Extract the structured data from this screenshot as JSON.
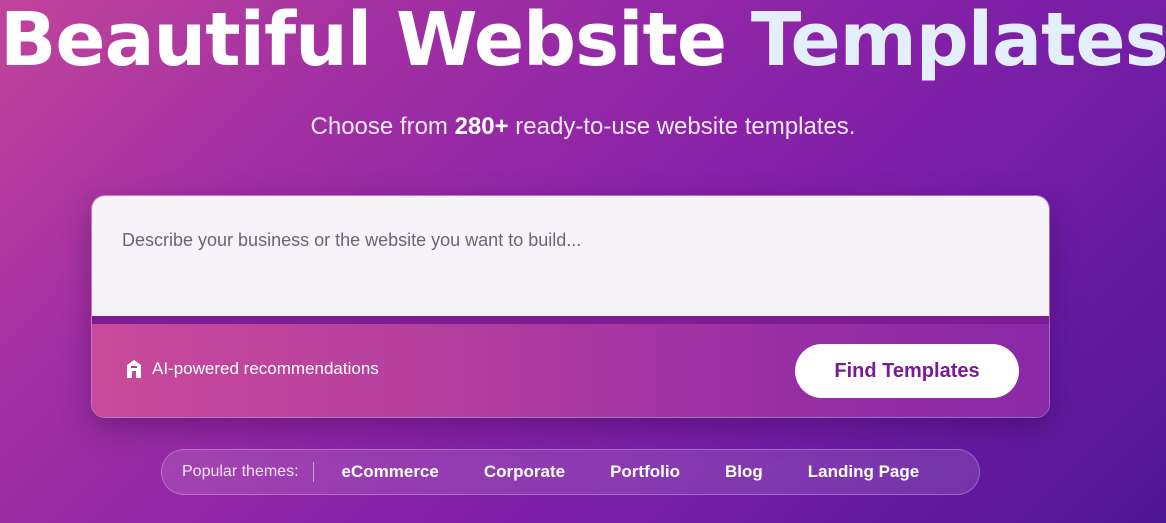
{
  "hero": {
    "title_word1": "Beautiful Website",
    "title_word2": "Templates",
    "subtitle_prefix": "Choose from ",
    "subtitle_count": "280+",
    "subtitle_suffix": " ready-to-use website templates."
  },
  "search": {
    "placeholder": "Describe your business or the website you want to build...",
    "ai_note": "AI-powered recommendations",
    "ai_icon": "house-icon",
    "button_label": "Find Templates"
  },
  "themes": {
    "label": "Popular themes:",
    "items": [
      "eCommerce",
      "Corporate",
      "Portfolio",
      "Blog",
      "Landing Page"
    ]
  },
  "colors": {
    "accent": "#7a1a95",
    "gradient_start": "#c2459c",
    "gradient_end": "#4e1694"
  }
}
